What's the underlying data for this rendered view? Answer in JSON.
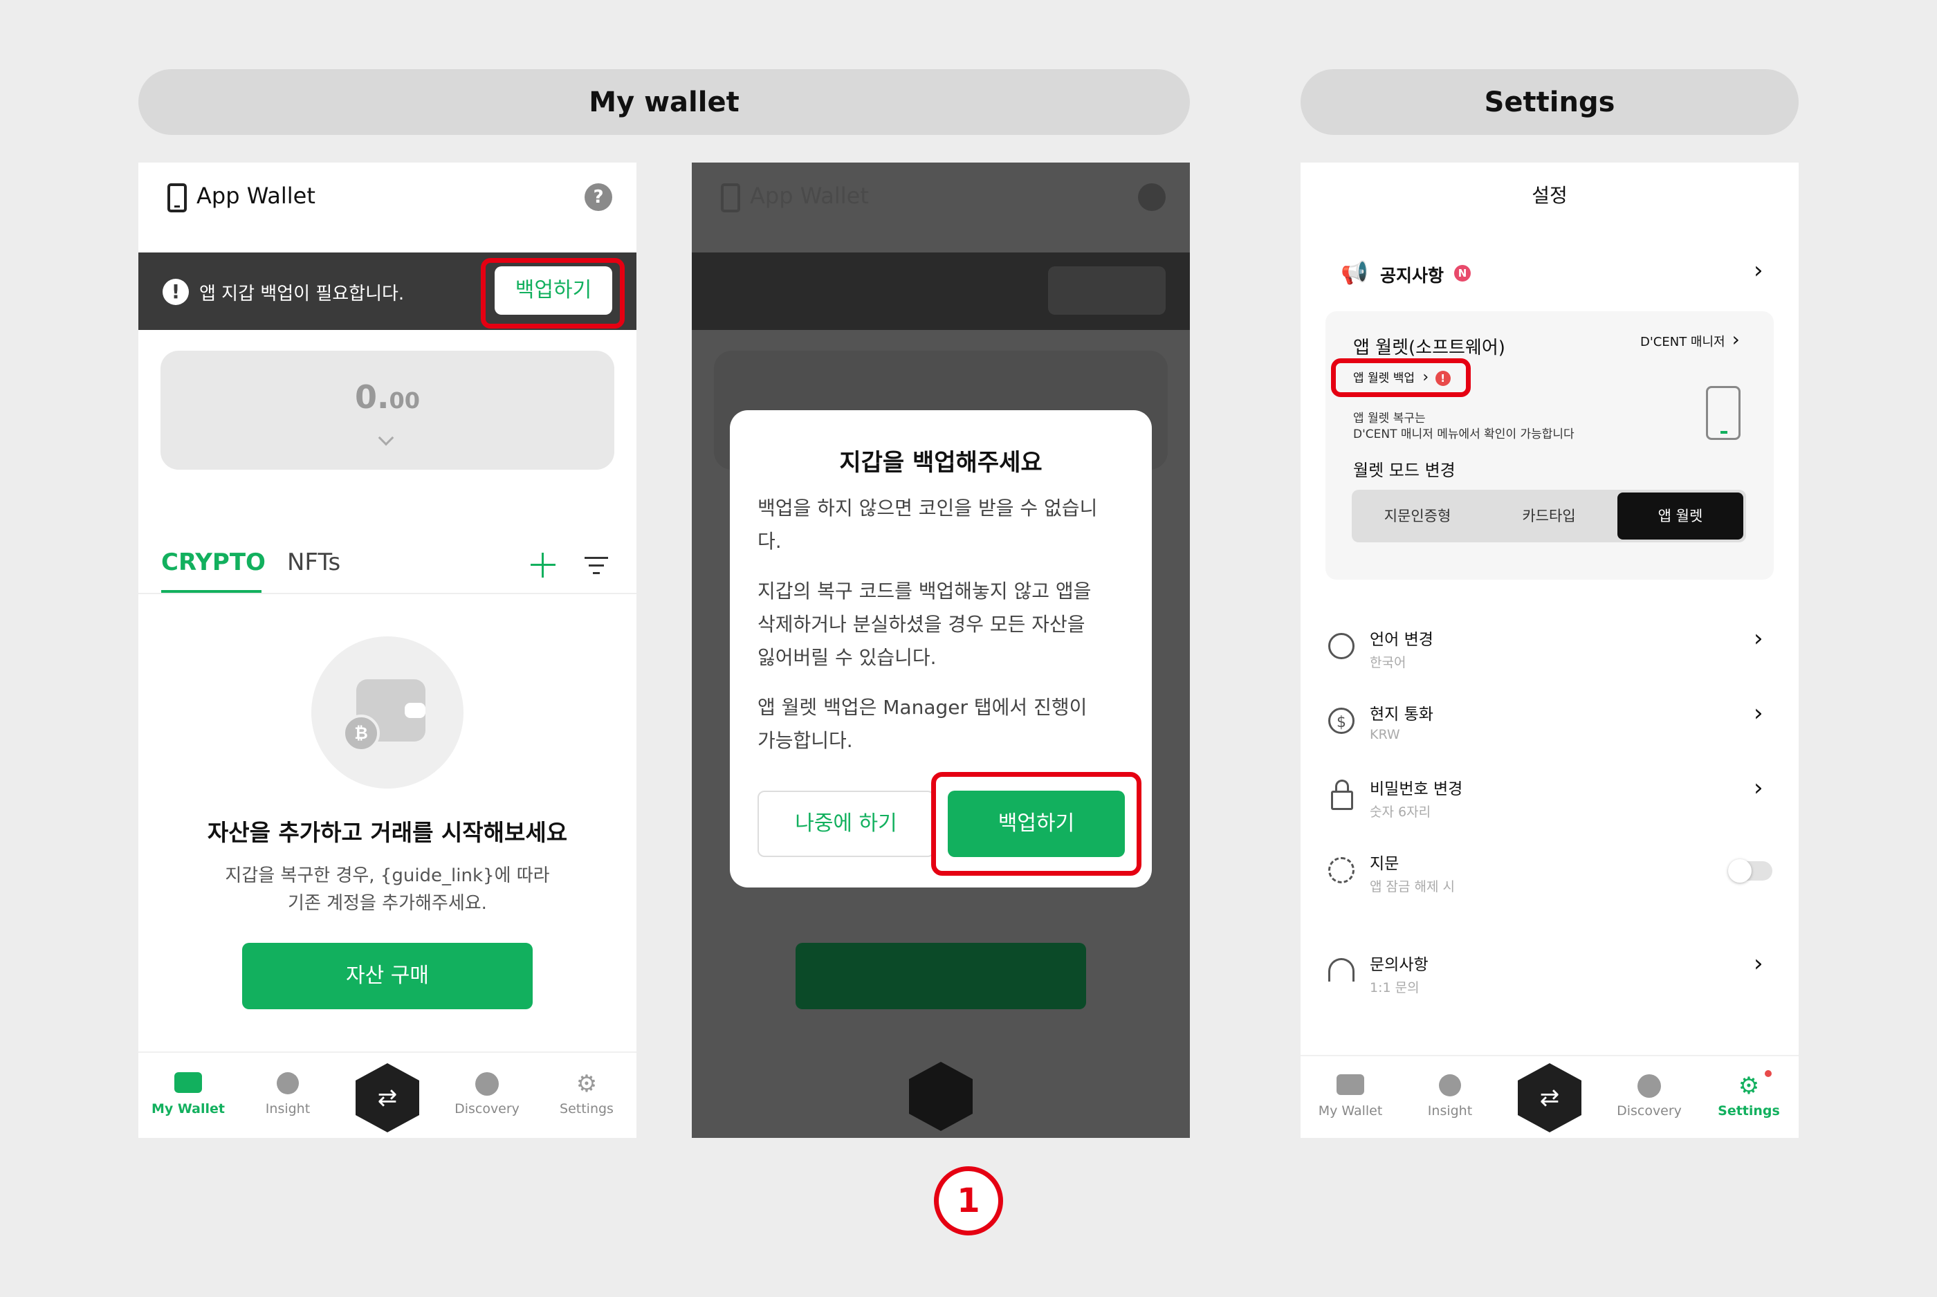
{
  "headers": {
    "my_wallet": "My wallet",
    "settings": "Settings"
  },
  "screen1": {
    "wallet_title": "App Wallet",
    "help_icon": "?",
    "banner_text": "앱 지갑 백업이 필요합니다.",
    "banner_button": "백업하기",
    "balance_int": "0.",
    "balance_dec": "00",
    "tab_crypto": "CRYPTO",
    "tab_nfts": "NFTs",
    "empty_title": "자산을 추가하고 거래를 시작해보세요",
    "empty_desc_1": "지갑을 복구한 경우, {guide_link}에 따라",
    "empty_desc_2": "기존 계정을 추가해주세요.",
    "buy_button": "자산 구매",
    "nav": [
      "My Wallet",
      "Insight",
      "Discovery",
      "Settings"
    ]
  },
  "screen2": {
    "bg_wallet_title": "App Wallet",
    "modal_title": "지갑을 백업해주세요",
    "para1_l1": "백업을 하지 않으면 코인을 받을 수 없습니",
    "para1_l2": "다.",
    "para2_l1": "지갑의 복구 코드를 백업해놓지 않고 앱을",
    "para2_l2": "삭제하거나 분실하셨을 경우 모든 자산을",
    "para2_l3": "잃어버릴 수 있습니다.",
    "para3_l1": "앱 월렛 백업은 Manager 탭에서 진행이",
    "para3_l2": "가능합니다.",
    "later_button": "나중에 하기",
    "backup_button": "백업하기",
    "step_number": "1"
  },
  "screen3": {
    "title": "설정",
    "notice_label": "공지사항",
    "notice_badge": "N",
    "app_wallet_label": "앱 월렛(소프트웨어)",
    "dcent_manager": "D'CENT 매니저",
    "backup_link": "앱 월렛 백업",
    "backup_alert": "!",
    "recovery_l1": "앱 월렛 복구는",
    "recovery_l2": "D'CENT 매니저 메뉴에서 확인이 가능합니다",
    "mode_change": "월렛 모드 변경",
    "modes": [
      "지문인증형",
      "카드타입",
      "앱 월렛"
    ],
    "rows": [
      {
        "title": "언어 변경",
        "sub": "한국어"
      },
      {
        "title": "현지 통화",
        "sub": "KRW"
      },
      {
        "title": "비밀번호 변경",
        "sub": "숫자 6자리"
      },
      {
        "title": "지문",
        "sub": "앱 잠금 해제 시"
      },
      {
        "title": "문의사항",
        "sub": "1:1 문의"
      }
    ],
    "nav": [
      "My Wallet",
      "Insight",
      "Discovery",
      "Settings"
    ]
  },
  "colors": {
    "accent": "#12b05e",
    "highlight": "#e50012",
    "banner_bg": "#3a3a3a"
  }
}
